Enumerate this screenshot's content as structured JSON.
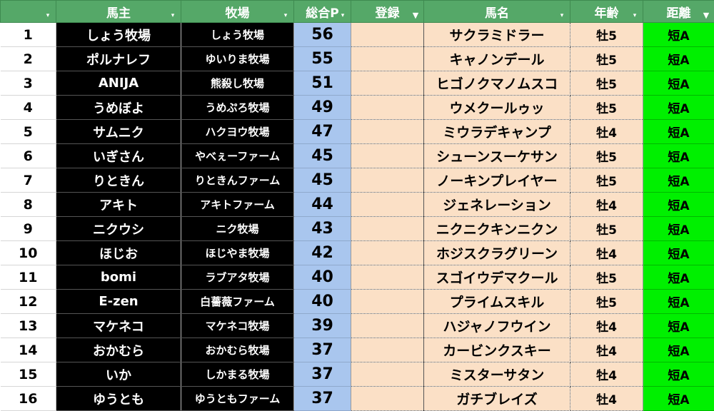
{
  "colors": {
    "header": "#55a868",
    "owner_bg": "#000000",
    "points_bg": "#a9c6ee",
    "entry_bg": "#fbe0c6",
    "distance_bg": "#00f000"
  },
  "headers": [
    {
      "label": "",
      "filter": "dropdown"
    },
    {
      "label": "馬主",
      "filter": "dropdown"
    },
    {
      "label": "牧場",
      "filter": "dropdown"
    },
    {
      "label": "総合P",
      "filter": "dropdown"
    },
    {
      "label": "登録",
      "filter": "active"
    },
    {
      "label": "馬名",
      "filter": "dropdown"
    },
    {
      "label": "年齢",
      "filter": "dropdown"
    },
    {
      "label": "距離",
      "filter": "active"
    }
  ],
  "filter_icons": {
    "dropdown": "▾",
    "active": "▼"
  },
  "rows": [
    {
      "no": "1",
      "owner": "しょう牧場",
      "farm": "しょう牧場",
      "points": "56",
      "entry": "",
      "horse": "サクラミドラー",
      "age": "牡5",
      "distance": "短A"
    },
    {
      "no": "2",
      "owner": "ポルナレフ",
      "farm": "ゆいりま牧場",
      "points": "55",
      "entry": "",
      "horse": "キャノンデール",
      "age": "牡5",
      "distance": "短A"
    },
    {
      "no": "3",
      "owner": "ANIJA",
      "farm": "熊殺し牧場",
      "points": "51",
      "entry": "",
      "horse": "ヒゴノクマノムスコ",
      "age": "牡5",
      "distance": "短A"
    },
    {
      "no": "4",
      "owner": "うめぼよ",
      "farm": "うめぷろ牧場",
      "points": "49",
      "entry": "",
      "horse": "ウメクールゥッ",
      "age": "牡5",
      "distance": "短A"
    },
    {
      "no": "5",
      "owner": "サムニク",
      "farm": "ハクヨウ牧場",
      "points": "47",
      "entry": "",
      "horse": "ミウラデキャンプ",
      "age": "牡4",
      "distance": "短A"
    },
    {
      "no": "6",
      "owner": "いぎさん",
      "farm": "やべぇーファーム",
      "points": "45",
      "entry": "",
      "horse": "シューンスーケサン",
      "age": "牡5",
      "distance": "短A"
    },
    {
      "no": "7",
      "owner": "りときん",
      "farm": "りときんファーム",
      "points": "45",
      "entry": "",
      "horse": "ノーキンプレイヤー",
      "age": "牡5",
      "distance": "短A"
    },
    {
      "no": "8",
      "owner": "アキト",
      "farm": "アキトファーム",
      "points": "44",
      "entry": "",
      "horse": "ジェネレーション",
      "age": "牡4",
      "distance": "短A"
    },
    {
      "no": "9",
      "owner": "ニクウシ",
      "farm": "ニク牧場",
      "points": "43",
      "entry": "",
      "horse": "ニクニクキンニクン",
      "age": "牡5",
      "distance": "短A"
    },
    {
      "no": "10",
      "owner": "ほじお",
      "farm": "ほじやま牧場",
      "points": "42",
      "entry": "",
      "horse": "ホジスクラグリーン",
      "age": "牡4",
      "distance": "短A"
    },
    {
      "no": "11",
      "owner": "bomi",
      "farm": "ラブアタ牧場",
      "points": "40",
      "entry": "",
      "horse": "スゴイウデマクール",
      "age": "牡5",
      "distance": "短A"
    },
    {
      "no": "12",
      "owner": "E-zen",
      "farm": "白薔薇ファーム",
      "points": "40",
      "entry": "",
      "horse": "プライムスキル",
      "age": "牡5",
      "distance": "短A"
    },
    {
      "no": "13",
      "owner": "マケネコ",
      "farm": "マケネコ牧場",
      "points": "39",
      "entry": "",
      "horse": "ハジャノフウイン",
      "age": "牡4",
      "distance": "短A"
    },
    {
      "no": "14",
      "owner": "おかむら",
      "farm": "おかむら牧場",
      "points": "37",
      "entry": "",
      "horse": "カービンクスキー",
      "age": "牡4",
      "distance": "短A"
    },
    {
      "no": "15",
      "owner": "いか",
      "farm": "しかまる牧場",
      "points": "37",
      "entry": "",
      "horse": "ミスターサタン",
      "age": "牡4",
      "distance": "短A"
    },
    {
      "no": "16",
      "owner": "ゆうとも",
      "farm": "ゆうともファーム",
      "points": "37",
      "entry": "",
      "horse": "ガチブレイズ",
      "age": "牡4",
      "distance": "短A"
    }
  ]
}
